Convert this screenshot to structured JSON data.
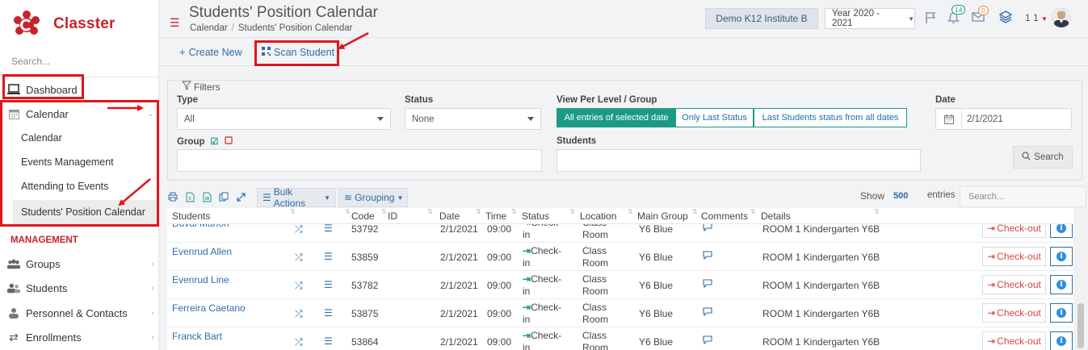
{
  "app": {
    "name": "Classter"
  },
  "sidebar": {
    "search_placeholder": "Search...",
    "dashboard": "Dashboard",
    "calendar": "Calendar",
    "calendar_sub": [
      "Calendar",
      "Events Management",
      "Attending to Events",
      "Students' Position Calendar"
    ],
    "section_title": "MANAGEMENT",
    "management_items": [
      "Groups",
      "Students",
      "Personnel & Contacts",
      "Enrollments"
    ]
  },
  "header": {
    "page_title": "Students' Position Calendar",
    "breadcrumb": [
      "Calendar",
      "Students' Position Calendar"
    ],
    "institute": "Demo K12 Institute B",
    "year": "Year 2020 - 2021",
    "bell_badge": "14",
    "mail_badge": "0",
    "user_number": "1 1"
  },
  "toolbar": {
    "create_new": "Create New",
    "scan_student": "Scan Student"
  },
  "filters": {
    "legend": "Filters",
    "type_label": "Type",
    "type_value": "All",
    "status_label": "Status",
    "status_value": "None",
    "view_label": "View Per Level / Group",
    "view_options": [
      "All entries of selected date",
      "Only Last Status",
      "Last Students status from all dates"
    ],
    "date_label": "Date",
    "date_value": "2/1/2021",
    "group_label": "Group",
    "students_label": "Students",
    "search_button": "Search"
  },
  "table_toolbar": {
    "bulk_actions": "Bulk Actions",
    "grouping": "Grouping",
    "show_label": "Show",
    "show_value": "500",
    "entries_label": "entries",
    "search_placeholder": "Search..."
  },
  "table": {
    "columns": [
      "Students",
      "Code",
      "ID",
      "Date",
      "Time",
      "Status",
      "Location",
      "Main Group",
      "Comments",
      "Details"
    ],
    "checkout_label": "Check-out",
    "rows": [
      {
        "name": "Duval Marion",
        "code": "53792",
        "id": "",
        "date": "2/1/2021",
        "time": "09:00",
        "status_1": "Check-",
        "status_2": "in",
        "location_1": "Class",
        "location_2": "Room",
        "group": "Y6 Blue",
        "details": "ROOM 1 Kindergarten Y6B"
      },
      {
        "name": "Evenrud Allen",
        "code": "53859",
        "id": "",
        "date": "2/1/2021",
        "time": "09:00",
        "status_1": "Check-",
        "status_2": "in",
        "location_1": "Class",
        "location_2": "Room",
        "group": "Y6 Blue",
        "details": "ROOM 1 Kindergarten Y6B"
      },
      {
        "name": "Evenrud Line",
        "code": "53782",
        "id": "",
        "date": "2/1/2021",
        "time": "09:00",
        "status_1": "Check-",
        "status_2": "in",
        "location_1": "Class",
        "location_2": "Room",
        "group": "Y6 Blue",
        "details": "ROOM 1 Kindergarten Y6B"
      },
      {
        "name": "Ferreira Caetano",
        "code": "53875",
        "id": "",
        "date": "2/1/2021",
        "time": "09:00",
        "status_1": "Check-",
        "status_2": "in",
        "location_1": "Class",
        "location_2": "Room",
        "group": "Y6 Blue",
        "details": "ROOM 1 Kindergarten Y6B"
      },
      {
        "name": "Franck Bart",
        "code": "53864",
        "id": "",
        "date": "2/1/2021",
        "time": "09:00",
        "status_1": "Check-",
        "status_2": "in",
        "location_1": "Class",
        "location_2": "Room",
        "group": "Y6 Blue",
        "details": "ROOM 1 Kindergarten Y6B"
      }
    ]
  },
  "colors": {
    "brand": "#c8232c",
    "accent": "#1c9a86",
    "link": "#2f6da6",
    "annotation": "#e0161d"
  }
}
